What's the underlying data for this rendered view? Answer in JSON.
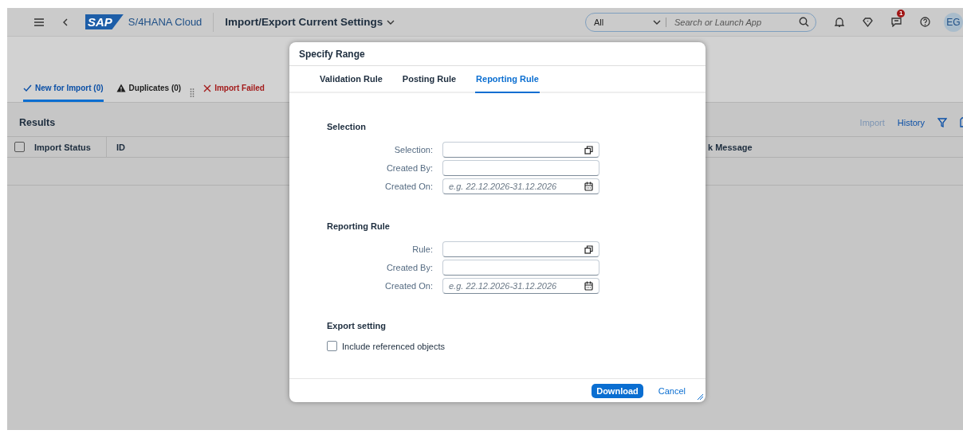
{
  "shell": {
    "logo": "SAP",
    "product": "S/4HANA Cloud",
    "title": "Import/Export Current Settings",
    "search": {
      "scope": "All",
      "placeholder": "Search or Launch App"
    },
    "notification_count": "1",
    "avatar": "EG"
  },
  "page_tabs": [
    {
      "label": "New for Import (0)",
      "kind": "success",
      "selected": true
    },
    {
      "label": "Duplicates (0)",
      "kind": "warning",
      "selected": false
    },
    {
      "label": "Import Failed",
      "kind": "error",
      "selected": false
    }
  ],
  "results": {
    "title": "Results",
    "actions": [
      {
        "label": "Import",
        "disabled": true
      },
      {
        "label": "History",
        "disabled": false
      }
    ],
    "select_all_checked": false,
    "columns": [
      "Import Status",
      "ID",
      "k Message"
    ]
  },
  "dialog": {
    "title": "Specify Range",
    "tabs": [
      {
        "label": "Validation Rule",
        "selected": false
      },
      {
        "label": "Posting Rule",
        "selected": false
      },
      {
        "label": "Reporting Rule",
        "selected": true
      }
    ],
    "sections": [
      {
        "title": "Selection",
        "fields": [
          {
            "label": "Selection:",
            "kind": "value_help"
          },
          {
            "label": "Created By:",
            "kind": "text"
          },
          {
            "label": "Created On:",
            "kind": "date",
            "placeholder": "e.g. 22.12.2026-31.12.2026"
          }
        ]
      },
      {
        "title": "Reporting Rule",
        "fields": [
          {
            "label": "Rule:",
            "kind": "value_help"
          },
          {
            "label": "Created By:",
            "kind": "text"
          },
          {
            "label": "Created On:",
            "kind": "date",
            "placeholder": "e.g. 22.12.2026-31.12.2026"
          }
        ]
      }
    ],
    "export_setting": {
      "title": "Export setting",
      "checkbox": {
        "label": "Include referenced objects",
        "checked": false
      }
    },
    "buttons": [
      {
        "label": "Download",
        "kind": "emphasized"
      },
      {
        "label": "Cancel",
        "kind": "transparent"
      }
    ]
  }
}
